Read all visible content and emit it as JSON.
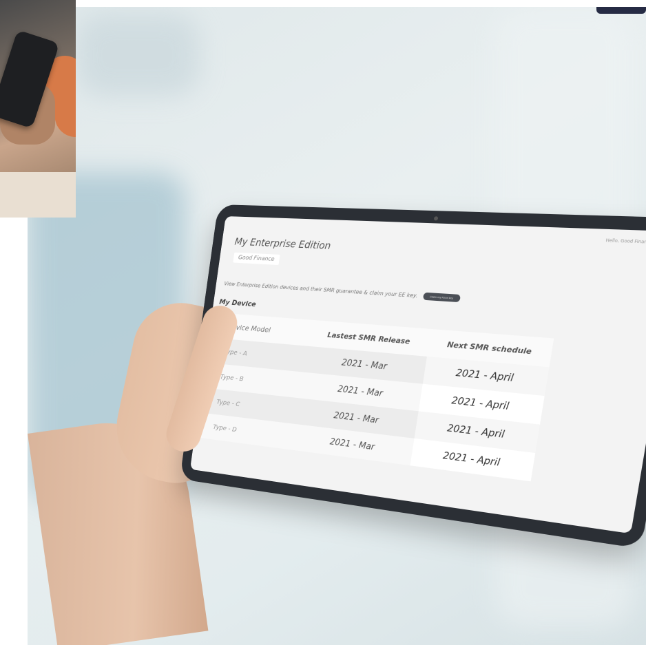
{
  "tablet_ui": {
    "greeting": "Hello, Good Finance!",
    "page_title": "My Enterprise Edition",
    "company": "Good Finance",
    "intro_text": "View Enterprise Edition devices and their SMR guarantee & claim your EE key.",
    "claim_button": "Claim my Knox key",
    "section_title": "My Device",
    "table": {
      "headers": [
        "Device Model",
        "Lastest SMR Release",
        "Next SMR schedule"
      ],
      "rows": [
        [
          "Type - A",
          "2021 - Mar",
          "2021 - April"
        ],
        [
          "Type - B",
          "2021 - Mar",
          "2021 - April"
        ],
        [
          "Type - C",
          "2021 - Mar",
          "2021 - April"
        ],
        [
          "Type - D",
          "2021 - Mar",
          "2021 - April"
        ]
      ]
    }
  },
  "colors": {
    "background": "#e3ecee",
    "tablet_frame": "#2b2f35",
    "screen": "#f3f3f3",
    "button": "#4b4f56"
  }
}
